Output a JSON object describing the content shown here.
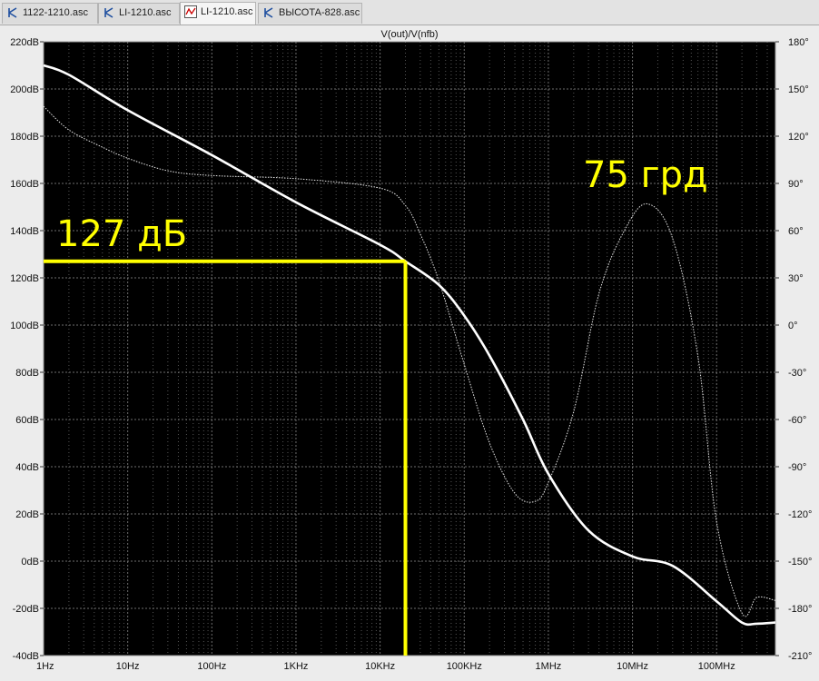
{
  "tabs": [
    {
      "label": "1122-1210.asc",
      "icon": "schematic-icon",
      "active": false
    },
    {
      "label": "LI-1210.asc",
      "icon": "schematic-icon",
      "active": false
    },
    {
      "label": "LI-1210.asc",
      "icon": "waveform-icon",
      "active": true
    },
    {
      "label": "ВЫСОТА-828.asc",
      "icon": "schematic-icon",
      "active": false
    }
  ],
  "annotations": {
    "gain_label": "127 дБ",
    "phase_label": "75 грд",
    "color": "#ffff00"
  },
  "colors": {
    "plot_background": "#000000",
    "grid": "#7a7a7a",
    "trace": "#ffffff",
    "marker": "#ffff00"
  },
  "chart_data": {
    "type": "line",
    "title": "V(out)/V(nfb)",
    "x_scale": "log",
    "xlim": [
      1,
      500000000
    ],
    "x_ticks": [
      "1Hz",
      "10Hz",
      "100Hz",
      "1KHz",
      "10KHz",
      "100KHz",
      "1MHz",
      "10MHz",
      "100MHz"
    ],
    "y_left_ticks": [
      "220dB",
      "200dB",
      "180dB",
      "160dB",
      "140dB",
      "120dB",
      "100dB",
      "80dB",
      "60dB",
      "40dB",
      "20dB",
      "0dB",
      "-20dB",
      "-40dB"
    ],
    "y_right_ticks": [
      "180°",
      "150°",
      "120°",
      "90°",
      "60°",
      "30°",
      "0°",
      "-30°",
      "-60°",
      "-90°",
      "-120°",
      "-150°",
      "-180°",
      "-210°"
    ],
    "ylim_left": [
      -40,
      220
    ],
    "ylim_right": [
      -210,
      180
    ],
    "grid": true,
    "series": [
      {
        "style": "solid",
        "axis": "left",
        "x": [
          1,
          2,
          10,
          100,
          1000,
          10000,
          20000,
          50000,
          100000,
          200000,
          500000,
          1000000,
          3000000,
          10000000,
          30000000,
          100000000,
          200000000,
          300000000,
          500000000
        ],
        "values": [
          210,
          206,
          191,
          172,
          152,
          134,
          127,
          117,
          104,
          87,
          60,
          37,
          13,
          2,
          -2,
          -17,
          -26,
          -26.5,
          -26
        ]
      },
      {
        "style": "dotted",
        "axis": "right",
        "x": [
          1,
          2,
          5,
          10,
          30,
          100,
          1000,
          10000,
          20000,
          30000,
          50000,
          100000,
          200000,
          400000,
          700000,
          1000000,
          2000000,
          4000000,
          8000000,
          15000000,
          30000000,
          60000000,
          100000000,
          200000000,
          300000000,
          500000000
        ],
        "values": [
          139,
          124,
          113,
          106,
          98,
          95,
          93,
          87,
          76,
          58,
          28,
          -25,
          -75,
          -107,
          -112,
          -100,
          -55,
          20,
          60,
          77,
          55,
          -20,
          -125,
          -183,
          -173,
          -175
        ]
      }
    ]
  },
  "marker": {
    "x": 20000,
    "y": 127
  }
}
